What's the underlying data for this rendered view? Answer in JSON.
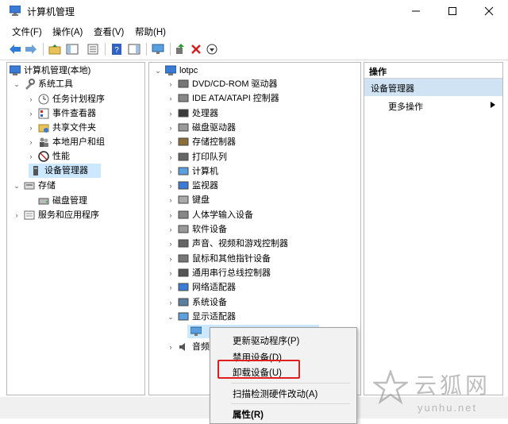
{
  "window": {
    "title": "计算机管理",
    "controls": [
      "minimize-icon",
      "maximize-icon",
      "close-icon"
    ]
  },
  "menubar": {
    "items": [
      "文件(F)",
      "操作(A)",
      "查看(V)",
      "帮助(H)"
    ]
  },
  "left_tree": {
    "root": "计算机管理(本地)",
    "system_tools": "系统工具",
    "task_scheduler": "任务计划程序",
    "event_viewer": "事件查看器",
    "shared_folders": "共享文件夹",
    "local_users": "本地用户和组",
    "performance": "性能",
    "device_manager": "设备管理器",
    "storage": "存储",
    "disk_management": "磁盘管理",
    "services_apps": "服务和应用程序"
  },
  "device_tree": {
    "computer": "lotpc",
    "items": [
      "DVD/CD-ROM 驱动器",
      "IDE ATA/ATAPI 控制器",
      "处理器",
      "磁盘驱动器",
      "存储控制器",
      "打印队列",
      "计算机",
      "监视器",
      "键盘",
      "人体学输入设备",
      "软件设备",
      "声音、视频和游戏控制器",
      "鼠标和其他指针设备",
      "通用串行总线控制器",
      "网络适配器",
      "系统设备",
      "显示适配器"
    ],
    "partial_item": "音频"
  },
  "actions": {
    "header": "操作",
    "section": "设备管理器",
    "more": "更多操作"
  },
  "context_menu": {
    "items": [
      "更新驱动程序(P)",
      "禁用设备(D)",
      "卸载设备(U)",
      "扫描检测硬件改动(A)",
      "属性(R)"
    ],
    "highlighted": "卸载设备(U)"
  },
  "watermark": {
    "text": "云狐网",
    "url": "yunhu.net"
  },
  "colors": {
    "selection": "#cce8ff",
    "action_section": "#cfe3f5",
    "highlight_box": "#e02020"
  }
}
